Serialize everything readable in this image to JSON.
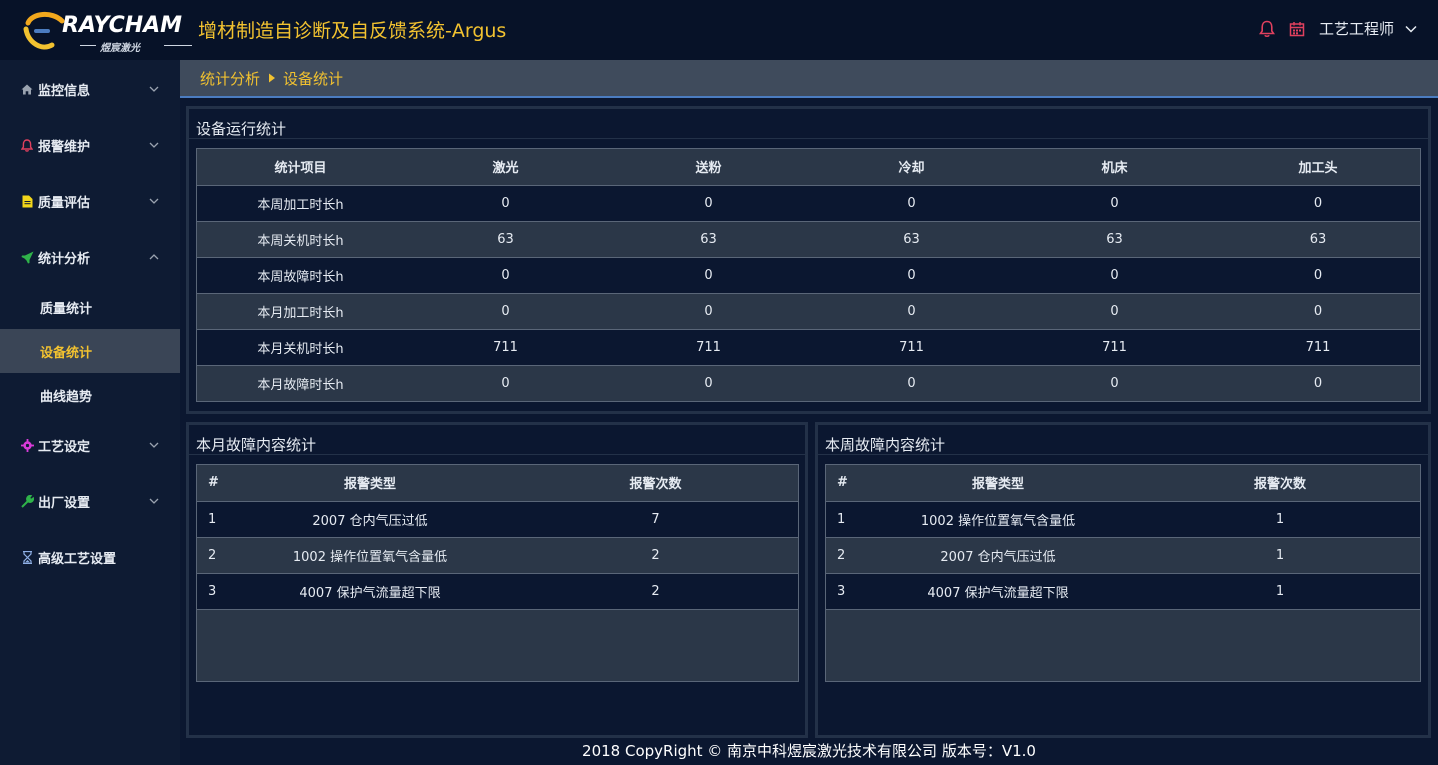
{
  "header": {
    "logo_text": "RAYCHAM",
    "logo_sub": "煜宸激光",
    "title": "增材制造自诊断及自反馈系统-Argus",
    "user_name": "工艺工程师",
    "icons": [
      "bell-icon",
      "calendar-icon",
      "chevron-down-icon"
    ],
    "accent_color": "#f2c230"
  },
  "sidebar": {
    "items": [
      {
        "label": "监控信息",
        "icon": "home-icon",
        "expanded": false
      },
      {
        "label": "报警维护",
        "icon": "bell-icon",
        "expanded": false
      },
      {
        "label": "质量评估",
        "icon": "document-icon",
        "expanded": false
      },
      {
        "label": "统计分析",
        "icon": "rocket-icon",
        "expanded": true
      },
      {
        "label": "工艺设定",
        "icon": "gear-icon",
        "expanded": false
      },
      {
        "label": "出厂设置",
        "icon": "wrench-icon",
        "expanded": false
      },
      {
        "label": "高级工艺设置",
        "icon": "hourglass-icon",
        "expanded": false
      }
    ],
    "submenu": [
      {
        "label": "质量统计",
        "active": false
      },
      {
        "label": "设备统计",
        "active": true
      },
      {
        "label": "曲线趋势",
        "active": false
      }
    ]
  },
  "breadcrumb": {
    "parent": "统计分析",
    "current": "设备统计"
  },
  "device_stats": {
    "title": "设备运行统计",
    "columns": [
      "统计项目",
      "激光",
      "送粉",
      "冷却",
      "机床",
      "加工头"
    ],
    "rows": [
      [
        "本周加工时长h",
        "0",
        "0",
        "0",
        "0",
        "0"
      ],
      [
        "本周关机时长h",
        "63",
        "63",
        "63",
        "63",
        "63"
      ],
      [
        "本周故障时长h",
        "0",
        "0",
        "0",
        "0",
        "0"
      ],
      [
        "本月加工时长h",
        "0",
        "0",
        "0",
        "0",
        "0"
      ],
      [
        "本月关机时长h",
        "711",
        "711",
        "711",
        "711",
        "711"
      ],
      [
        "本月故障时长h",
        "0",
        "0",
        "0",
        "0",
        "0"
      ]
    ]
  },
  "month_faults": {
    "title": "本月故障内容统计",
    "columns": [
      "#",
      "报警类型",
      "报警次数"
    ],
    "rows": [
      [
        "1",
        "2007 仓内气压过低",
        "7"
      ],
      [
        "2",
        "1002 操作位置氧气含量低",
        "2"
      ],
      [
        "3",
        "4007 保护气流量超下限",
        "2"
      ]
    ]
  },
  "week_faults": {
    "title": "本周故障内容统计",
    "columns": [
      "#",
      "报警类型",
      "报警次数"
    ],
    "rows": [
      [
        "1",
        "1002 操作位置氧气含量低",
        "1"
      ],
      [
        "2",
        "2007 仓内气压过低",
        "1"
      ],
      [
        "3",
        "4007 保护气流量超下限",
        "1"
      ]
    ]
  },
  "footer": {
    "text": "2018 CopyRight © 南京中科煜宸激光技术有限公司 版本号：V1.0"
  }
}
